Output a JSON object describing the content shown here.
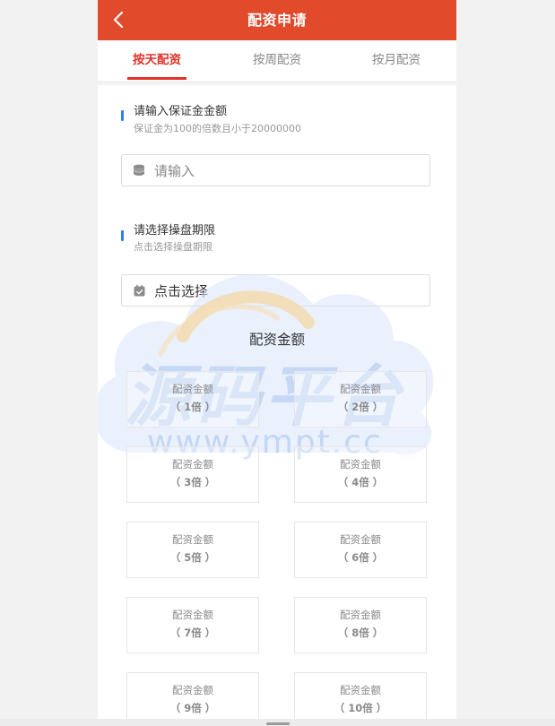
{
  "header": {
    "title": "配资申请"
  },
  "tabs": [
    {
      "label": "按天配资",
      "active": true
    },
    {
      "label": "按周配资",
      "active": false
    },
    {
      "label": "按月配资",
      "active": false
    }
  ],
  "deposit": {
    "title": "请输入保证金金额",
    "hint": "保证金为100的倍数且小于20000000",
    "placeholder": "请输入"
  },
  "period": {
    "title": "请选择操盘期限",
    "hint": "点击选择操盘期限",
    "value": "点击选择"
  },
  "multiples": {
    "title": "配资金额",
    "cards": [
      {
        "label": "配资金额",
        "multiple": "（ 1倍 ）"
      },
      {
        "label": "配资金额",
        "multiple": "（ 2倍 ）"
      },
      {
        "label": "配资金额",
        "multiple": "（ 3倍 ）"
      },
      {
        "label": "配资金额",
        "multiple": "（ 4倍 ）"
      },
      {
        "label": "配资金额",
        "multiple": "（ 5倍 ）"
      },
      {
        "label": "配资金额",
        "multiple": "（ 6倍 ）"
      },
      {
        "label": "配资金额",
        "multiple": "（ 7倍 ）"
      },
      {
        "label": "配资金额",
        "multiple": "（ 8倍 ）"
      },
      {
        "label": "配资金额",
        "multiple": "（ 9倍 ）"
      },
      {
        "label": "配资金额",
        "multiple": "（ 10倍 ）"
      }
    ]
  },
  "watermark": {
    "brand": "源码平台",
    "url": "www.ympt.cc"
  },
  "icons": {
    "back": "chevron-left-icon",
    "coins": "coins-icon",
    "calendar": "calendar-icon"
  },
  "colors": {
    "primary": "#e24a2c",
    "accent": "#e0322a",
    "marker": "#2f7ff2"
  }
}
